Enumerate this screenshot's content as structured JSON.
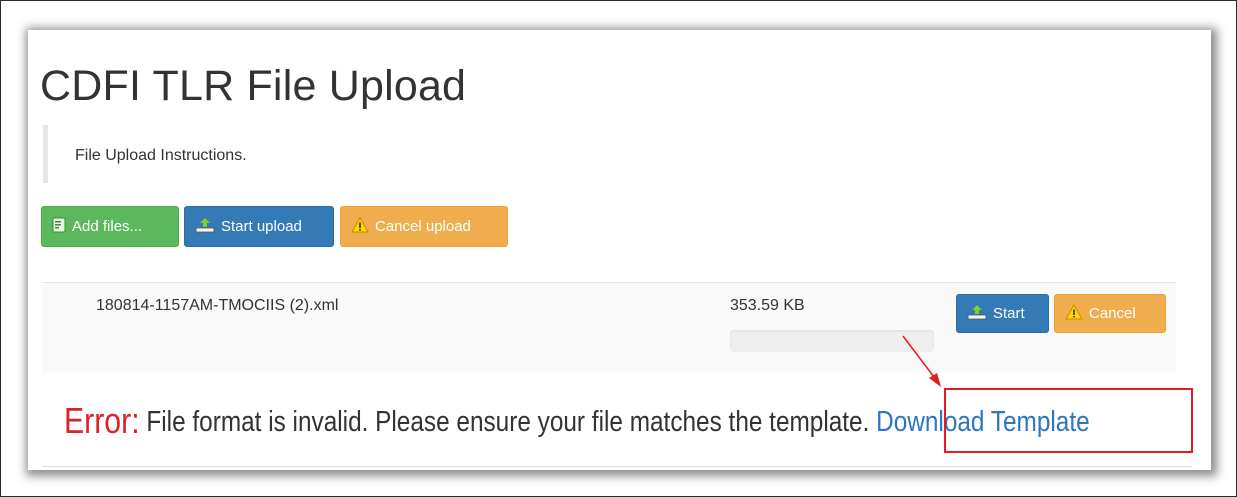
{
  "page": {
    "title": "CDFI TLR File Upload",
    "instructions": "File Upload Instructions."
  },
  "toolbar": {
    "add_files_label": "Add files...",
    "start_upload_label": "Start upload",
    "cancel_upload_label": "Cancel upload"
  },
  "file": {
    "name": "180814-1157AM-TMOCIIS (2).xml",
    "size": "353.59 KB",
    "progress": 0,
    "start_label": "Start",
    "cancel_label": "Cancel"
  },
  "error": {
    "label": "Error:",
    "message": " File format is invalid. Please ensure your file matches the template. ",
    "link_label": "Download Template"
  },
  "icons": {
    "add_files": "file-add-icon",
    "upload": "upload-icon",
    "warning": "warning-icon"
  },
  "colors": {
    "success": "#5cb85c",
    "primary": "#337ab7",
    "warning": "#f0ad4e",
    "error": "#d9232a",
    "link": "#2b77c2",
    "annotation": "#e31b23"
  }
}
